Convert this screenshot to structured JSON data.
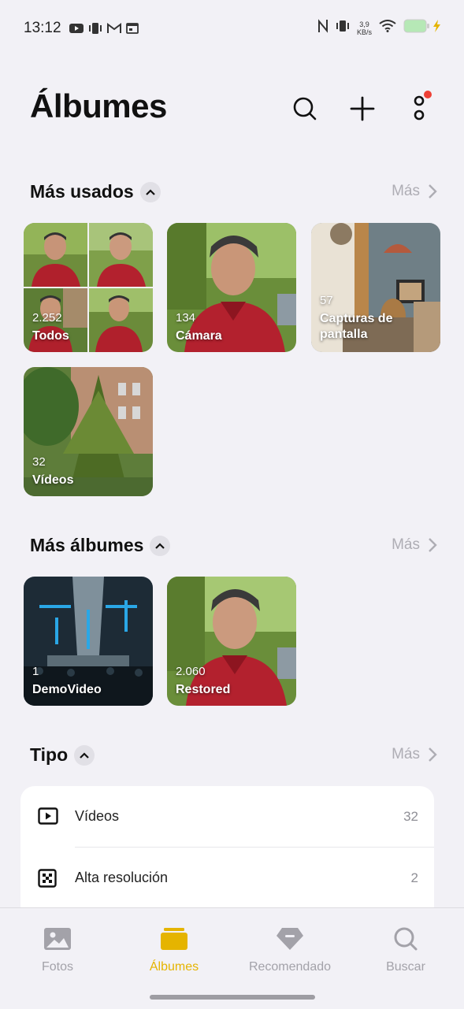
{
  "status_bar": {
    "time": "13:12",
    "net_speed_value": "3,9",
    "net_speed_unit": "KB/s",
    "left_icons": [
      "youtube-icon",
      "vibrate-icon",
      "gmail-icon",
      "calendar-icon"
    ],
    "right_icons": [
      "nfc-icon",
      "vibrate-icon",
      "wifi-icon",
      "battery-icon",
      "charging-icon"
    ]
  },
  "header": {
    "title": "Álbumes",
    "actions": [
      "search-icon",
      "plus-icon",
      "more-options-icon"
    ]
  },
  "sections": {
    "most_used": {
      "title": "Más usados",
      "more_label": "Más",
      "albums": [
        {
          "count": "2.252",
          "name": "Todos"
        },
        {
          "count": "134",
          "name": "Cámara"
        },
        {
          "count": "57",
          "name": "Capturas de pantalla"
        },
        {
          "count": "32",
          "name": "Vídeos"
        }
      ]
    },
    "more_albums": {
      "title": "Más álbumes",
      "more_label": "Más",
      "albums": [
        {
          "count": "1",
          "name": "DemoVideo"
        },
        {
          "count": "2.060",
          "name": "Restored"
        }
      ]
    },
    "type": {
      "title": "Tipo",
      "more_label": "Más",
      "items": [
        {
          "label": "Vídeos",
          "count": "32",
          "icon": "video-icon"
        },
        {
          "label": "Alta resolución",
          "count": "2",
          "icon": "high-resolution-icon"
        }
      ]
    }
  },
  "bottom_nav": {
    "items": [
      {
        "label": "Fotos",
        "icon": "photos-icon"
      },
      {
        "label": "Álbumes",
        "icon": "albums-icon",
        "active": true
      },
      {
        "label": "Recomendado",
        "icon": "recommended-icon"
      },
      {
        "label": "Buscar",
        "icon": "search-icon"
      }
    ]
  },
  "colors": {
    "accent": "#e5b400",
    "background": "#f2f1f6",
    "notification_dot": "#ee4035"
  }
}
